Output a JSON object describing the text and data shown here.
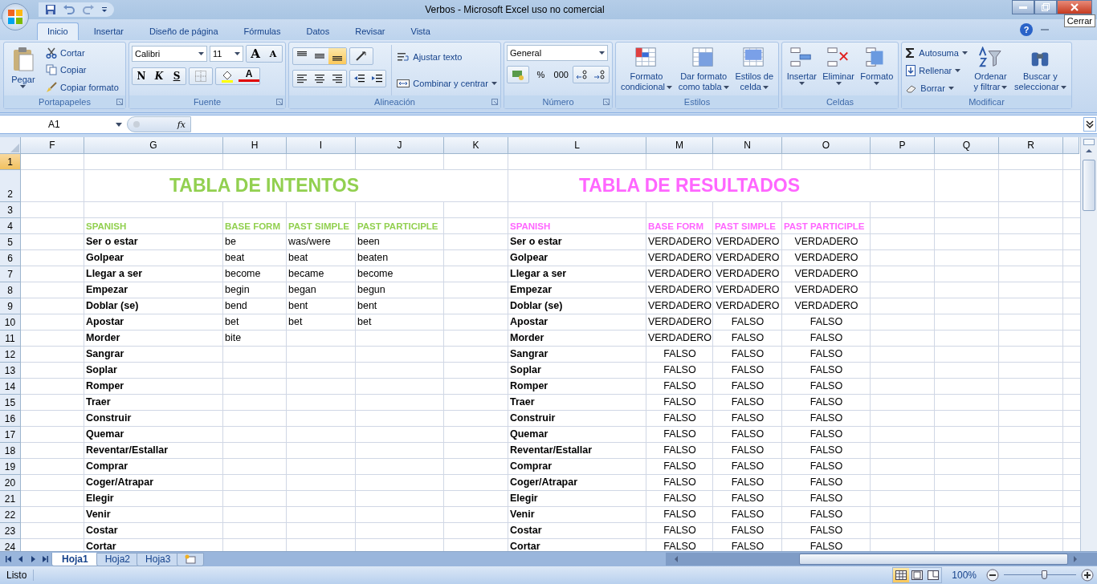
{
  "window": {
    "title": "Verbos - Microsoft Excel uso no comercial",
    "tooltip": "Cerrar"
  },
  "ribbon_tabs": [
    {
      "label": "Inicio",
      "selected": true
    },
    {
      "label": "Insertar",
      "selected": false
    },
    {
      "label": "Diseño de página",
      "selected": false
    },
    {
      "label": "Fórmulas",
      "selected": false
    },
    {
      "label": "Datos",
      "selected": false
    },
    {
      "label": "Revisar",
      "selected": false
    },
    {
      "label": "Vista",
      "selected": false
    }
  ],
  "help": "?",
  "clipboard": {
    "label": "Portapapeles",
    "paste": "Pegar",
    "actions": [
      "Cortar",
      "Copiar",
      "Copiar formato"
    ]
  },
  "font": {
    "label": "Fuente",
    "name": "Calibri",
    "size": "11",
    "grow": "A",
    "shrink": "A",
    "bold": "N",
    "italic": "K",
    "underline": "S",
    "font_color_letter": "A"
  },
  "alignment": {
    "label": "Alineación",
    "vertical": [
      {
        "selected": false
      },
      {
        "selected": false
      },
      {
        "selected": true
      }
    ],
    "horizontal": [
      {
        "selected": false
      },
      {
        "selected": false
      },
      {
        "selected": false
      }
    ],
    "wrap": "Ajustar texto",
    "merge": "Combinar y centrar"
  },
  "number": {
    "label": "Número",
    "format": "General",
    "percent": "%",
    "thousands": "000"
  },
  "styles": {
    "label": "Estilos",
    "buttons": [
      {
        "lines": [
          "Formato",
          "condicional"
        ]
      },
      {
        "lines": [
          "Dar formato",
          "como tabla"
        ]
      },
      {
        "lines": [
          "Estilos de",
          "celda"
        ]
      }
    ]
  },
  "cells": {
    "label": "Celdas",
    "buttons": [
      "Insertar",
      "Eliminar",
      "Formato"
    ]
  },
  "editing": {
    "label": "Modificar",
    "actions": [
      "Autosuma",
      "Rellenar",
      "Borrar"
    ],
    "buttons": [
      {
        "lines": [
          "Ordenar",
          "y filtrar"
        ]
      },
      {
        "lines": [
          "Buscar y",
          "seleccionar"
        ]
      }
    ]
  },
  "formula_bar": {
    "name_box": "A1",
    "fx": "fx"
  },
  "sheet": {
    "columns": [
      "F",
      "G",
      "H",
      "I",
      "J",
      "K",
      "L",
      "M",
      "N",
      "O",
      "P",
      "Q",
      "R"
    ],
    "row_numbers": [
      {
        "label": "1",
        "selected": true
      },
      {
        "label": "2",
        "selected": false
      },
      {
        "label": "3",
        "selected": false
      },
      {
        "label": "4",
        "selected": false
      },
      {
        "label": "5",
        "selected": false
      },
      {
        "label": "6",
        "selected": false
      },
      {
        "label": "7",
        "selected": false
      },
      {
        "label": "8",
        "selected": false
      },
      {
        "label": "9",
        "selected": false
      },
      {
        "label": "10",
        "selected": false
      },
      {
        "label": "11",
        "selected": false
      },
      {
        "label": "12",
        "selected": false
      },
      {
        "label": "13",
        "selected": false
      },
      {
        "label": "14",
        "selected": false
      },
      {
        "label": "15",
        "selected": false
      },
      {
        "label": "16",
        "selected": false
      },
      {
        "label": "17",
        "selected": false
      },
      {
        "label": "18",
        "selected": false
      },
      {
        "label": "19",
        "selected": false
      },
      {
        "label": "20",
        "selected": false
      },
      {
        "label": "21",
        "selected": false
      },
      {
        "label": "22",
        "selected": false
      },
      {
        "label": "23",
        "selected": false
      },
      {
        "label": "24",
        "selected": false
      }
    ],
    "attempts": {
      "title": "TABLA DE INTENTOS",
      "color": "#92d050",
      "headers": [
        "SPANISH",
        "BASE FORM",
        "PAST SIMPLE",
        "PAST PARTICIPLE"
      ],
      "rows": [
        [
          "Ser o estar",
          "be",
          "was/were",
          "been"
        ],
        [
          "Golpear",
          "beat",
          "beat",
          "beaten"
        ],
        [
          "Llegar a ser",
          "become",
          "became",
          "become"
        ],
        [
          "Empezar",
          "begin",
          "began",
          "begun"
        ],
        [
          "Doblar (se)",
          "bend",
          "bent",
          "bent"
        ],
        [
          "Apostar",
          "bet",
          "bet",
          "bet"
        ],
        [
          "Morder",
          "bite"
        ],
        [
          "Sangrar"
        ],
        [
          "Soplar"
        ],
        [
          "Romper"
        ],
        [
          "Traer"
        ],
        [
          "Construir"
        ],
        [
          "Quemar"
        ],
        [
          "Reventar/Estallar"
        ],
        [
          "Comprar"
        ],
        [
          "Coger/Atrapar"
        ],
        [
          "Elegir"
        ],
        [
          "Venir"
        ],
        [
          "Costar"
        ],
        [
          "Cortar"
        ]
      ]
    },
    "results": {
      "title": "TABLA DE RESULTADOS",
      "color": "#ff66ff",
      "headers": [
        "SPANISH",
        "BASE FORM",
        "PAST SIMPLE",
        "PAST PARTICIPLE"
      ],
      "rows": [
        [
          "Ser o estar",
          "VERDADERO",
          "VERDADERO",
          "VERDADERO"
        ],
        [
          "Golpear",
          "VERDADERO",
          "VERDADERO",
          "VERDADERO"
        ],
        [
          "Llegar a ser",
          "VERDADERO",
          "VERDADERO",
          "VERDADERO"
        ],
        [
          "Empezar",
          "VERDADERO",
          "VERDADERO",
          "VERDADERO"
        ],
        [
          "Doblar (se)",
          "VERDADERO",
          "VERDADERO",
          "VERDADERO"
        ],
        [
          "Apostar",
          "VERDADERO",
          "FALSO",
          "FALSO"
        ],
        [
          "Morder",
          "VERDADERO",
          "FALSO",
          "FALSO"
        ],
        [
          "Sangrar",
          "FALSO",
          "FALSO",
          "FALSO"
        ],
        [
          "Soplar",
          "FALSO",
          "FALSO",
          "FALSO"
        ],
        [
          "Romper",
          "FALSO",
          "FALSO",
          "FALSO"
        ],
        [
          "Traer",
          "FALSO",
          "FALSO",
          "FALSO"
        ],
        [
          "Construir",
          "FALSO",
          "FALSO",
          "FALSO"
        ],
        [
          "Quemar",
          "FALSO",
          "FALSO",
          "FALSO"
        ],
        [
          "Reventar/Estallar",
          "FALSO",
          "FALSO",
          "FALSO"
        ],
        [
          "Comprar",
          "FALSO",
          "FALSO",
          "FALSO"
        ],
        [
          "Coger/Atrapar",
          "FALSO",
          "FALSO",
          "FALSO"
        ],
        [
          "Elegir",
          "FALSO",
          "FALSO",
          "FALSO"
        ],
        [
          "Venir",
          "FALSO",
          "FALSO",
          "FALSO"
        ],
        [
          "Costar",
          "FALSO",
          "FALSO",
          "FALSO"
        ],
        [
          "Cortar",
          "FALSO",
          "FALSO",
          "FALSO"
        ]
      ]
    }
  },
  "sheet_tabs": [
    {
      "label": "Hoja1",
      "selected": true
    },
    {
      "label": "Hoja2",
      "selected": false
    },
    {
      "label": "Hoja3",
      "selected": false
    }
  ],
  "status_bar": {
    "status": "Listo",
    "views": [
      {
        "selected": true
      },
      {
        "selected": false
      },
      {
        "selected": false
      }
    ],
    "zoom": "100%",
    "zoom_slider": {
      "level": 0.55
    }
  }
}
